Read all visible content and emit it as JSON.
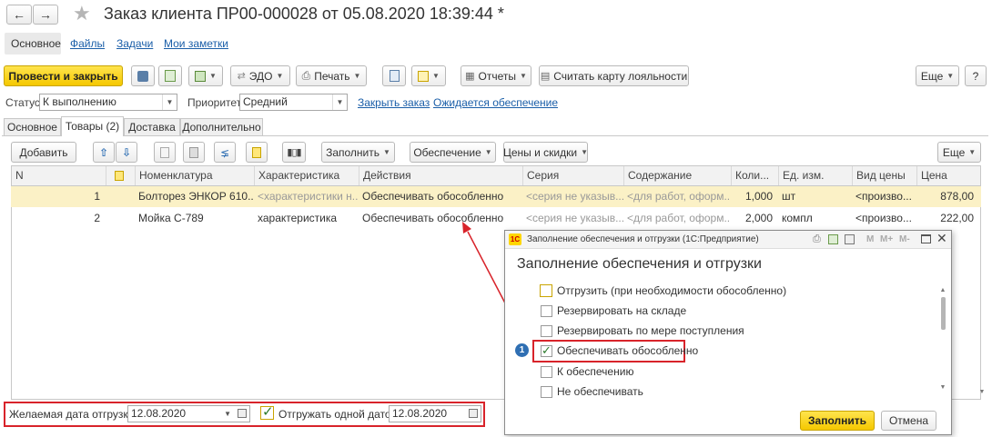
{
  "window": {
    "title": "Заказ клиента ПР00-000028 от 05.08.2020 18:39:44 *"
  },
  "nav_tabs": [
    "Основное",
    "Файлы",
    "Задачи",
    "Мои заметки"
  ],
  "toolbar": {
    "post_close": "Провести и закрыть",
    "edo": "ЭДО",
    "print": "Печать",
    "reports": "Отчеты",
    "loyalty": "Считать карту лояльности",
    "more": "Еще",
    "help": "?"
  },
  "status_row": {
    "status_label": "Статус:",
    "status_value": "К выполнению",
    "priority_label": "Приоритет:",
    "priority_value": "Средний",
    "close_order": "Закрыть заказ",
    "awaiting": "Ожидается обеспечение"
  },
  "form_tabs": [
    "Основное",
    "Товары (2)",
    "Доставка",
    "Дополнительно"
  ],
  "goods_toolbar": {
    "add": "Добавить",
    "fill": "Заполнить",
    "provision": "Обеспечение",
    "prices": "Цены и скидки",
    "more": "Еще"
  },
  "table": {
    "columns": [
      "N",
      "",
      "Номенклатура",
      "Характеристика",
      "Действия",
      "Серия",
      "Содержание",
      "Коли...",
      "Ед. изм.",
      "Вид цены",
      "Цена"
    ],
    "rows": [
      [
        "1",
        "",
        "Болторез ЭНКОР 610...",
        "<характеристики н...",
        "Обеспечивать обособленно",
        "<серия не указыв...",
        "<для работ, оформ...",
        "1,000",
        "шт",
        "<произво...",
        "878,00"
      ],
      [
        "2",
        "",
        "Мойка С-789",
        "характеристика",
        "Обеспечивать обособленно",
        "<серия не указыв...",
        "<для работ, оформ...",
        "2,000",
        "компл",
        "<произво...",
        "222,00"
      ]
    ]
  },
  "bottom": {
    "ship_date_label": "Желаемая дата отгрузки:",
    "ship_date_value": "12.08.2020",
    "ship_one_date_label": "Отгружать одной датой",
    "ship_one_date_value": "12.08.2020"
  },
  "dialog": {
    "titlebar": "Заполнение обеспечения и отгрузки (1С:Предприятие)",
    "heading": "Заполнение обеспечения и отгрузки",
    "options": [
      {
        "label": "Отгрузить (при необходимости обособленно)",
        "checked": false
      },
      {
        "label": "Резервировать на складе",
        "checked": false
      },
      {
        "label": "Резервировать по мере поступления",
        "checked": false
      },
      {
        "label": "Обеспечивать обособленно",
        "checked": true
      },
      {
        "label": "К обеспечению",
        "checked": false
      },
      {
        "label": "Не обеспечивать",
        "checked": false
      }
    ],
    "step_badge": "1",
    "fill_button": "Заполнить",
    "cancel_button": "Отмена",
    "m_buttons": [
      "M",
      "M+",
      "M-"
    ]
  },
  "colors": {
    "accent_yellow": "#ffd600",
    "selected_row": "#fbf1c6",
    "link": "#1a5ea8",
    "highlight_red": "#d8232a",
    "badge_blue": "#2f6fb3"
  }
}
